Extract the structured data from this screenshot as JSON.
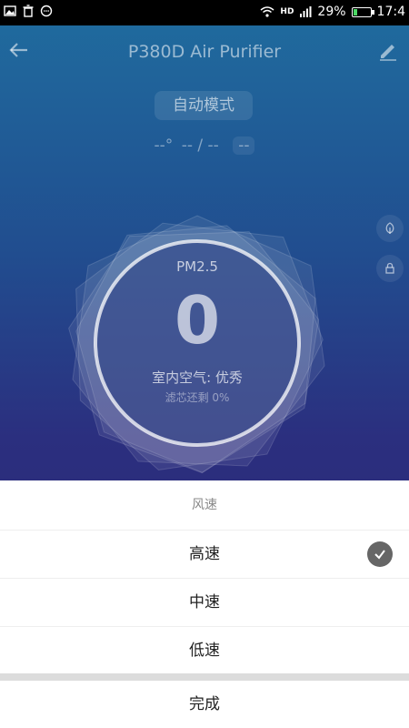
{
  "status_bar": {
    "network_label": "HD",
    "battery": "29%",
    "time": "17:4",
    "battery_level": 0.29
  },
  "header": {
    "title": "P380D Air Purifier"
  },
  "mode": {
    "label": "自动模式"
  },
  "environment": {
    "temperature": "--°",
    "humidity": "-- / --",
    "extra": "--"
  },
  "gauge": {
    "metric_label": "PM2.5",
    "value": "0",
    "air_quality": "室内空气: 优秀",
    "filter_remaining": "滤芯还剩 0%"
  },
  "sheet": {
    "title": "风速",
    "options": [
      {
        "label": "高速",
        "selected": true
      },
      {
        "label": "中速",
        "selected": false
      },
      {
        "label": "低速",
        "selected": false
      }
    ],
    "done_label": "完成"
  },
  "colors": {
    "check_bg": "#666666"
  }
}
